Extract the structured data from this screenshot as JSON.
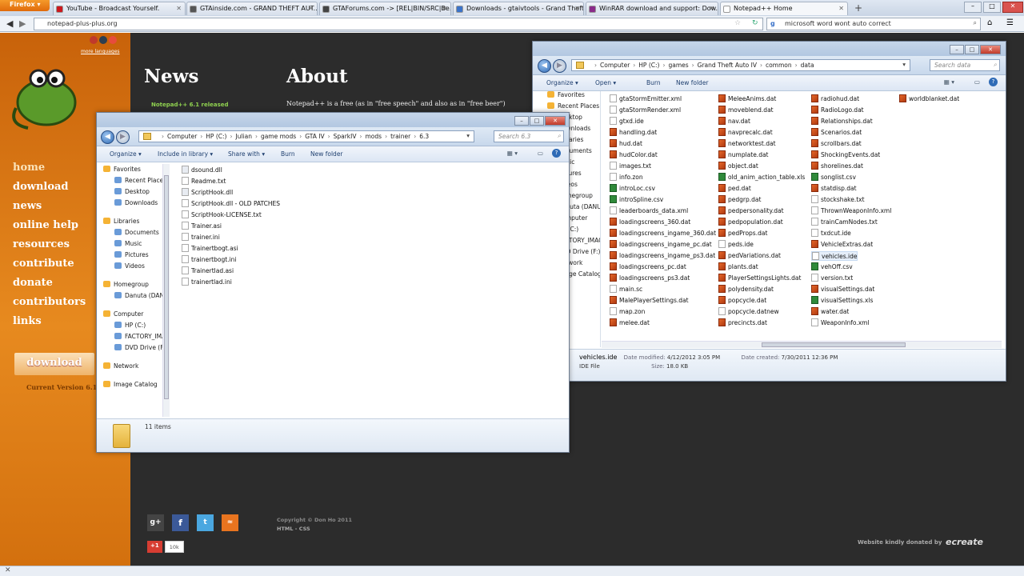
{
  "browser": {
    "brand": "Firefox",
    "tabs": [
      {
        "label": "YouTube - Broadcast Yourself.",
        "color": "#cc181e"
      },
      {
        "label": "GTAinside.com - GRAND THEFT AUT...",
        "color": "#555555"
      },
      {
        "label": "GTAForums.com -> [REL|BIN/SRC|Be...",
        "color": "#444444"
      },
      {
        "label": "Downloads - gtaivtools - Grand Theft...",
        "color": "#3b73c9"
      },
      {
        "label": "WinRAR download and support: Dow...",
        "color": "#8a2b8a"
      },
      {
        "label": "Notepad++ Home",
        "color": "#ffffff"
      }
    ],
    "new_tab": "+",
    "url": "notepad-plus-plus.org",
    "search_value": "microsoft word wont auto correct"
  },
  "site": {
    "more_languages": "more languages",
    "nav": [
      "home",
      "download",
      "news",
      "online help",
      "resources",
      "contribute",
      "donate",
      "contributors",
      "links"
    ],
    "news_heading": "News",
    "news_item": "Notepad++ 6.1 released",
    "about_heading": "About",
    "about_text": "Notepad++ is a free (as in \"free speech\" and also as in \"free beer\")",
    "download_btn": "download",
    "current_version": "Current Version 6.1",
    "copyright": "Copyright © Don Ho 2011",
    "html_css": "HTML - CSS",
    "donated_by": "Website kindly donated by",
    "donor": "ecreate",
    "gplus": "+1",
    "gplus_count": "10k"
  },
  "explorer_small": {
    "breadcrumb": [
      "Computer",
      "HP (C:)",
      "Julian",
      "game mods",
      "GTA IV",
      "SparkIV",
      "mods",
      "trainer",
      "6.3"
    ],
    "search_placeholder": "Search 6.3",
    "toolbar": [
      "Organize ▾",
      "Include in library ▾",
      "Share with ▾",
      "Burn",
      "New folder"
    ],
    "nav": [
      {
        "label": "Favorites",
        "group": true
      },
      {
        "label": "Recent Places"
      },
      {
        "label": "Desktop"
      },
      {
        "label": "Downloads"
      },
      {
        "label": "Libraries",
        "group": true
      },
      {
        "label": "Documents"
      },
      {
        "label": "Music"
      },
      {
        "label": "Pictures"
      },
      {
        "label": "Videos"
      },
      {
        "label": "Homegroup",
        "group": true
      },
      {
        "label": "Danuta (DANUTA-PC)"
      },
      {
        "label": "Computer",
        "group": true
      },
      {
        "label": "HP (C:)"
      },
      {
        "label": "FACTORY_IMAGE"
      },
      {
        "label": "DVD Drive (F:)"
      },
      {
        "label": "Network",
        "group": true
      },
      {
        "label": "Image Catalog",
        "group": true
      }
    ],
    "files": [
      {
        "name": "dsound.dll",
        "type": "dll"
      },
      {
        "name": "Readme.txt",
        "type": "txt"
      },
      {
        "name": "ScriptHook.dll",
        "type": "dll"
      },
      {
        "name": "ScriptHook.dll - OLD PATCHES",
        "type": "txt"
      },
      {
        "name": "ScriptHook-LICENSE.txt",
        "type": "txt"
      },
      {
        "name": "Trainer.asi",
        "type": "txt"
      },
      {
        "name": "trainer.ini",
        "type": "txt"
      },
      {
        "name": "Trainertbogt.asi",
        "type": "txt"
      },
      {
        "name": "trainertbogt.ini",
        "type": "txt"
      },
      {
        "name": "Trainertlad.asi",
        "type": "txt"
      },
      {
        "name": "trainertlad.ini",
        "type": "txt"
      }
    ],
    "status": "11 items"
  },
  "explorer_big": {
    "breadcrumb": [
      "Computer",
      "HP (C:)",
      "games",
      "Grand Theft Auto IV",
      "common",
      "data"
    ],
    "search_placeholder": "Search data",
    "toolbar": [
      "Organize ▾",
      "Open ▾",
      "Burn",
      "New folder"
    ],
    "nav": [
      "Favorites",
      "Recent Places",
      "Desktop",
      "Downloads",
      "Libraries",
      "Documents",
      "Music",
      "Pictures",
      "Videos",
      "Homegroup",
      "Danuta (DANUTA-PC)",
      "Computer",
      "HP (C:)",
      "FACTORY_IMAGE",
      "DVD Drive (F:)",
      "Network",
      "Image Catalog"
    ],
    "columns": [
      [
        {
          "name": "gtaStormEmitter.xml",
          "type": "txt"
        },
        {
          "name": "gtaStormRender.xml",
          "type": "txt"
        },
        {
          "name": "gtxd.ide",
          "type": "txt"
        },
        {
          "name": "handling.dat",
          "type": "dat"
        },
        {
          "name": "hud.dat",
          "type": "dat"
        },
        {
          "name": "hudColor.dat",
          "type": "dat"
        },
        {
          "name": "images.txt",
          "type": "txt"
        },
        {
          "name": "info.zon",
          "type": "txt"
        },
        {
          "name": "introLoc.csv",
          "type": "xls"
        },
        {
          "name": "introSpline.csv",
          "type": "xls"
        },
        {
          "name": "leaderboards_data.xml",
          "type": "txt"
        },
        {
          "name": "loadingscreens_360.dat",
          "type": "dat"
        },
        {
          "name": "loadingscreens_ingame_360.dat",
          "type": "dat"
        },
        {
          "name": "loadingscreens_ingame_pc.dat",
          "type": "dat"
        },
        {
          "name": "loadingscreens_ingame_ps3.dat",
          "type": "dat"
        },
        {
          "name": "loadingscreens_pc.dat",
          "type": "dat"
        },
        {
          "name": "loadingscreens_ps3.dat",
          "type": "dat"
        },
        {
          "name": "main.sc",
          "type": "txt"
        },
        {
          "name": "MalePlayerSettings.dat",
          "type": "dat"
        },
        {
          "name": "map.zon",
          "type": "txt"
        },
        {
          "name": "melee.dat",
          "type": "dat"
        }
      ],
      [
        {
          "name": "MeleeAnims.dat",
          "type": "dat"
        },
        {
          "name": "moveblend.dat",
          "type": "dat"
        },
        {
          "name": "nav.dat",
          "type": "dat"
        },
        {
          "name": "navprecalc.dat",
          "type": "dat"
        },
        {
          "name": "networktest.dat",
          "type": "dat"
        },
        {
          "name": "numplate.dat",
          "type": "dat"
        },
        {
          "name": "object.dat",
          "type": "dat"
        },
        {
          "name": "old_anim_action_table.xls",
          "type": "xls"
        },
        {
          "name": "ped.dat",
          "type": "dat"
        },
        {
          "name": "pedgrp.dat",
          "type": "dat"
        },
        {
          "name": "pedpersonality.dat",
          "type": "dat"
        },
        {
          "name": "pedpopulation.dat",
          "type": "dat"
        },
        {
          "name": "pedProps.dat",
          "type": "dat"
        },
        {
          "name": "peds.ide",
          "type": "txt"
        },
        {
          "name": "pedVariations.dat",
          "type": "dat"
        },
        {
          "name": "plants.dat",
          "type": "dat"
        },
        {
          "name": "PlayerSettingsLights.dat",
          "type": "dat"
        },
        {
          "name": "polydensity.dat",
          "type": "dat"
        },
        {
          "name": "popcycle.dat",
          "type": "dat"
        },
        {
          "name": "popcycle.datnew",
          "type": "txt"
        },
        {
          "name": "precincts.dat",
          "type": "dat"
        }
      ],
      [
        {
          "name": "radiohud.dat",
          "type": "dat"
        },
        {
          "name": "RadioLogo.dat",
          "type": "dat"
        },
        {
          "name": "Relationships.dat",
          "type": "dat"
        },
        {
          "name": "Scenarios.dat",
          "type": "dat"
        },
        {
          "name": "scrollbars.dat",
          "type": "dat"
        },
        {
          "name": "ShockingEvents.dat",
          "type": "dat"
        },
        {
          "name": "shorelines.dat",
          "type": "dat"
        },
        {
          "name": "songlist.csv",
          "type": "xls"
        },
        {
          "name": "statdisp.dat",
          "type": "dat"
        },
        {
          "name": "stockshake.txt",
          "type": "txt"
        },
        {
          "name": "ThrownWeaponInfo.xml",
          "type": "txt"
        },
        {
          "name": "trainCamNodes.txt",
          "type": "txt"
        },
        {
          "name": "txdcut.ide",
          "type": "txt"
        },
        {
          "name": "VehicleExtras.dat",
          "type": "dat"
        },
        {
          "name": "vehicles.ide",
          "type": "txt"
        },
        {
          "name": "vehOff.csv",
          "type": "xls"
        },
        {
          "name": "version.txt",
          "type": "txt"
        },
        {
          "name": "visualSettings.dat",
          "type": "dat"
        },
        {
          "name": "visualSettings.xls",
          "type": "xls"
        },
        {
          "name": "water.dat",
          "type": "dat"
        },
        {
          "name": "WeaponInfo.xml",
          "type": "txt"
        }
      ],
      [
        {
          "name": "worldblanket.dat",
          "type": "dat"
        }
      ]
    ],
    "details": {
      "name": "vehicles.ide",
      "type": "IDE File",
      "modified_label": "Date modified:",
      "modified": "4/12/2012 3:05 PM",
      "created_label": "Date created:",
      "created": "7/30/2011 12:36 PM",
      "size_label": "Size:",
      "size": "18.0 KB"
    }
  }
}
